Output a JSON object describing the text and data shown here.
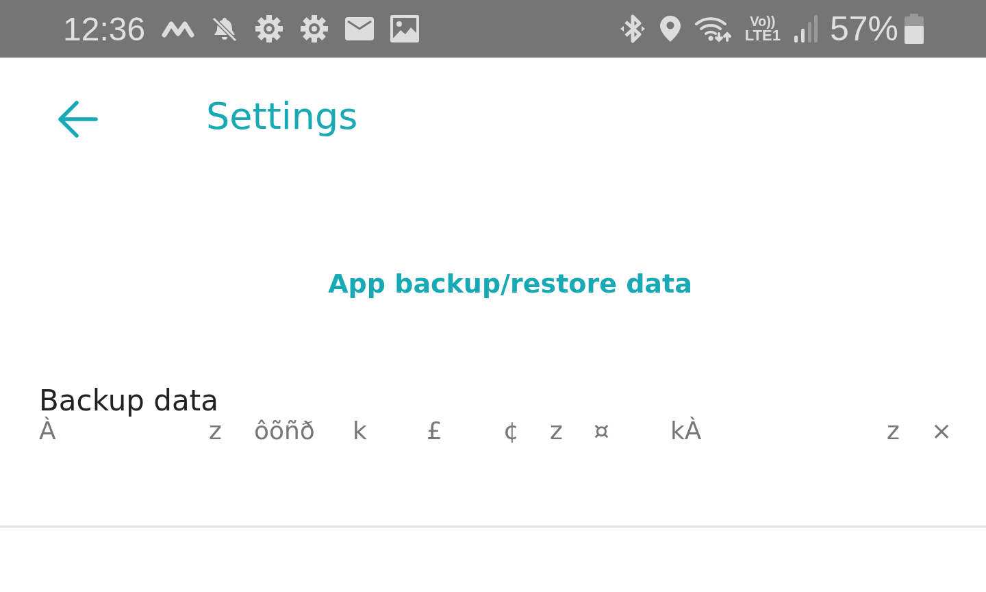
{
  "status_bar": {
    "time": "12:36",
    "battery_percent": "57%",
    "network_label_top": "Vo))",
    "network_label_bottom": "LTE1"
  },
  "app_bar": {
    "title": "Settings"
  },
  "section": {
    "title": "App backup/restore data"
  },
  "settings": [
    {
      "title": "Backup data",
      "summary_fragments": [
        "À",
        "z",
        "ôõñð",
        "k",
        "£",
        "¢",
        "z",
        "¤",
        "kÀ",
        "z",
        "×"
      ]
    }
  ]
}
